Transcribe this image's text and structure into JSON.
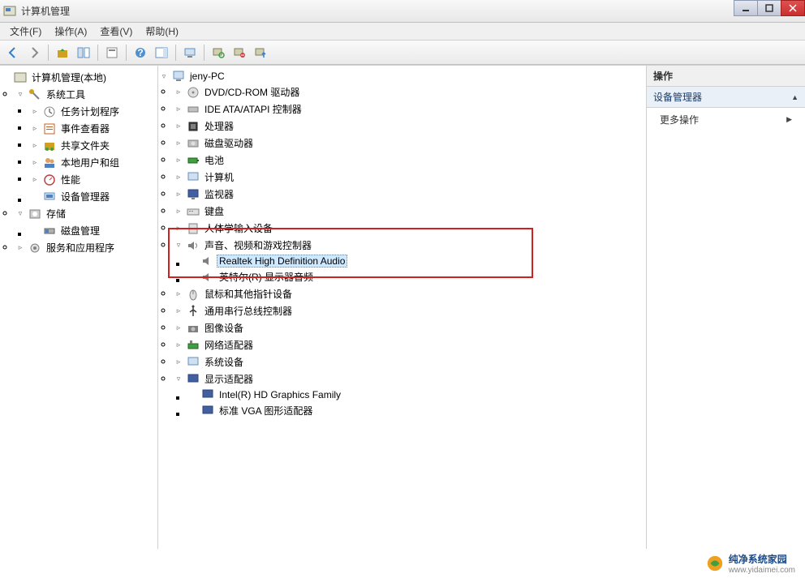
{
  "window": {
    "title": "计算机管理"
  },
  "menu": {
    "file": "文件(F)",
    "action": "操作(A)",
    "view": "查看(V)",
    "help": "帮助(H)"
  },
  "left_tree": {
    "root": "计算机管理(本地)",
    "system_tools": "系统工具",
    "task_scheduler": "任务计划程序",
    "event_viewer": "事件查看器",
    "shared_folders": "共享文件夹",
    "local_users": "本地用户和组",
    "performance": "性能",
    "device_manager": "设备管理器",
    "storage": "存储",
    "disk_management": "磁盘管理",
    "services_apps": "服务和应用程序"
  },
  "center_tree": {
    "computer": "jeny-PC",
    "dvd": "DVD/CD-ROM 驱动器",
    "ide": "IDE ATA/ATAPI 控制器",
    "cpu": "处理器",
    "disk_drive": "磁盘驱动器",
    "battery": "电池",
    "computer_cat": "计算机",
    "monitor": "监视器",
    "keyboard": "键盘",
    "hid": "人体学输入设备",
    "sound": "声音、视频和游戏控制器",
    "realtek": "Realtek High Definition Audio",
    "intel_audio": "英特尔(R) 显示器音频",
    "mouse": "鼠标和其他指针设备",
    "usb": "通用串行总线控制器",
    "imaging": "图像设备",
    "network": "网络适配器",
    "system_devices": "系统设备",
    "display": "显示适配器",
    "intel_hd": "Intel(R) HD Graphics Family",
    "vga": "标准 VGA 图形适配器"
  },
  "right": {
    "header": "操作",
    "section": "设备管理器",
    "more_actions": "更多操作"
  },
  "watermark": {
    "name": "纯净系统家园",
    "url": "www.yidaimei.com"
  }
}
